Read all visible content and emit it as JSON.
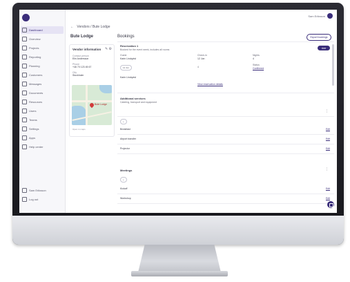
{
  "app": {
    "user_name": "Sam Eriksson",
    "brand_color": "#3a2d7a"
  },
  "sidebar": {
    "items": [
      {
        "label": "Dashboard",
        "icon": "home-icon"
      },
      {
        "label": "Overview",
        "icon": "grid-icon"
      },
      {
        "label": "Projects",
        "icon": "folder-icon"
      },
      {
        "label": "Reporting",
        "icon": "chart-icon"
      },
      {
        "label": "Planning",
        "icon": "calendar-icon"
      },
      {
        "label": "Customers",
        "icon": "users-icon"
      },
      {
        "label": "Messages",
        "icon": "chat-icon"
      },
      {
        "label": "Documents",
        "icon": "document-icon"
      },
      {
        "label": "Resources",
        "icon": "box-icon"
      },
      {
        "label": "Users",
        "icon": "user-icon"
      },
      {
        "label": "Teams",
        "icon": "team-icon"
      },
      {
        "label": "Settings",
        "icon": "gear-icon"
      },
      {
        "label": "Apps",
        "icon": "apps-icon"
      },
      {
        "label": "Help center",
        "icon": "help-icon"
      }
    ],
    "bottom": [
      {
        "label": "Sam Eriksson",
        "icon": "avatar-icon"
      },
      {
        "label": "Log out",
        "icon": "logout-icon"
      }
    ]
  },
  "breadcrumb": {
    "text": "Vendors / Bute Lodge"
  },
  "page_title": "Bute Lodge",
  "left_card": {
    "title": "Vendor information",
    "fields": [
      {
        "label": "Contact person",
        "value": "Elin Andersson"
      },
      {
        "label": "Phone",
        "value": "+46 70 123 45 67"
      },
      {
        "label": "City",
        "value": "Stockholm"
      }
    ],
    "map_label": "Bute Lodge",
    "map_caption": "Open in maps"
  },
  "main": {
    "title": "Bookings",
    "outline_button": "Export bookings",
    "primary_button": "Add",
    "section1": {
      "heading": "Reservation 1",
      "subheading": "Booked for the event week, includes all rooms",
      "fields": [
        {
          "label": "Guest",
          "value": "Karin Lindqvist"
        },
        {
          "label": "Check-in",
          "value": "12 Jun"
        },
        {
          "label": "Nights",
          "value": "4"
        },
        {
          "label": "Status",
          "value": "Confirmed"
        }
      ],
      "link": "View reservation details"
    },
    "section2": {
      "heading": "Additional services",
      "subheading": "Catering, transport and equipment",
      "rows": [
        {
          "label": "Breakfast",
          "value": "Edit"
        },
        {
          "label": "Airport transfer",
          "value": "Edit"
        },
        {
          "label": "Projector",
          "value": "Edit"
        }
      ]
    },
    "section3": {
      "heading": "Meetings",
      "rows": [
        {
          "label": "Kickoff",
          "value": "Edit"
        },
        {
          "label": "Workshop",
          "value": "Edit"
        }
      ]
    }
  }
}
